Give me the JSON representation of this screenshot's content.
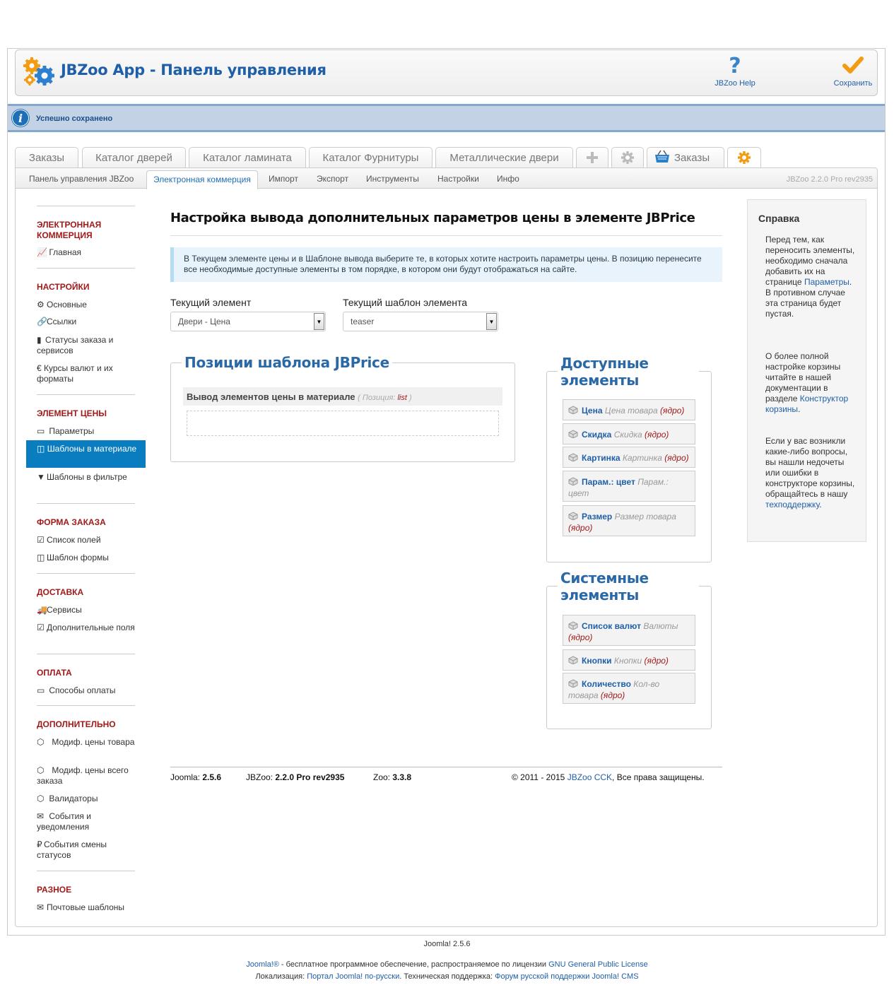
{
  "toolbar": {
    "title": "JBZoo App - Панель управления",
    "help_label": "JBZoo Help",
    "save_label": "Сохранить"
  },
  "message": "Успешно сохранено",
  "tabs": [
    {
      "label": "Заказы"
    },
    {
      "label": "Каталог дверей"
    },
    {
      "label": "Каталог ламината"
    },
    {
      "label": "Каталог Фурнитуры"
    },
    {
      "label": "Металлические двери"
    },
    {
      "label": ""
    },
    {
      "label": ""
    },
    {
      "label": "Заказы"
    },
    {
      "label": ""
    }
  ],
  "subnav": {
    "items": [
      {
        "label": "Панель управления JBZoo"
      },
      {
        "label": "Электронная коммерция"
      },
      {
        "label": "Импорт"
      },
      {
        "label": "Экспорт"
      },
      {
        "label": "Инструменты"
      },
      {
        "label": "Настройки"
      },
      {
        "label": "Инфо"
      }
    ],
    "version": "JBZoo 2.2.0 Pro rev2935"
  },
  "sidebar": {
    "sections": [
      {
        "title": "ЭЛЕКТРОННАЯ КОММЕРЦИЯ",
        "items": [
          "Главная"
        ]
      },
      {
        "title": "НАСТРОЙКИ",
        "items": [
          "Основные",
          "Ссылки",
          "Статусы заказа и сервисов",
          "Курсы валют и их форматы"
        ]
      },
      {
        "title": "ЭЛЕМЕНТ ЦЕНЫ",
        "items": [
          "Параметры",
          "Шаблоны в материале",
          "Шаблоны в фильтре"
        ]
      },
      {
        "title": "ФОРМА ЗАКАЗА",
        "items": [
          "Список полей",
          "Шаблон формы"
        ]
      },
      {
        "title": "ДОСТАВКА",
        "items": [
          "Сервисы",
          "Дополнительные поля"
        ]
      },
      {
        "title": "ОПЛАТА",
        "items": [
          "Способы оплаты"
        ]
      },
      {
        "title": "ДОПОЛНИТЕЛЬНО",
        "items": [
          "Модиф. цены товара",
          "Модиф. цены всего заказа",
          "Валидаторы",
          "События и уведомления",
          "События смены статусов"
        ]
      },
      {
        "title": "РАЗНОЕ",
        "items": [
          "Почтовые шаблоны"
        ]
      }
    ]
  },
  "main": {
    "title": "Настройка вывода дополнительных параметров цены в элементе JBPrice",
    "note": "В Текущем элементе цены и в Шаблоне вывода выберите те, в которых хотите настроить параметры цены. В позицию перенесите все необходимые доступные элементы в том порядке, в котором они будут отображаться на сайте.",
    "current_element_label": "Текущий элемент",
    "current_element_value": "Двери - Цена",
    "current_template_label": "Текущий шаблон элемента",
    "current_template_value": "teaser",
    "positions_title": "Позиции шаблона JBPrice",
    "position_name": "Вывод элементов цены в материале",
    "position_hint_prefix": "( Позиция:",
    "position_hint_key": "list",
    "position_hint_suffix": ")",
    "available_title": "Доступные элементы",
    "available": [
      {
        "name": "Цена",
        "desc": "Цена товара",
        "core": "(ядро)"
      },
      {
        "name": "Скидка",
        "desc": "Скидка",
        "core": "(ядро)"
      },
      {
        "name": "Картинка",
        "desc": "Картинка",
        "core": "(ядро)"
      },
      {
        "name": "Парам.: цвет",
        "desc": "Парам.: цвет",
        "core": ""
      },
      {
        "name": "Размер",
        "desc": "Размер товара",
        "core": "(ядро)"
      }
    ],
    "system_title": "Системные элементы",
    "system": [
      {
        "name": "Список валют",
        "desc": "Валюты",
        "core": "(ядро)"
      },
      {
        "name": "Кнопки",
        "desc": "Кнопки",
        "core": "(ядро)"
      },
      {
        "name": "Количество",
        "desc": "Кол-во товара",
        "core": "(ядро)"
      }
    ]
  },
  "help": {
    "title": "Справка",
    "p1_text": "Перед тем, как переносить элементы, необходимо сначала добавить их на странице",
    "p1_link": "Параметры",
    "p1_tail": ". В противном случае эта страница будет пустая.",
    "p2_text": "О более полной настройке корзины читайте в нашей документации в разделе",
    "p2_link": "Конструктор корзины",
    "p2_tail": ".",
    "p3_text": "Если у вас возникли какие-либо вопросы, вы нашли недочеты или ошибки в конструкторе корзины, обращайтесь в нашу",
    "p3_link": "техподдержку",
    "p3_tail": "."
  },
  "footer": {
    "joomla_label": "Joomla:",
    "joomla_ver": "2.5.6",
    "jbzoo_label": "JBZoo:",
    "jbzoo_ver": "2.2.0 Pro rev2935",
    "zoo_label": "Zoo:",
    "zoo_ver": "3.3.8",
    "copy_prefix": "© 2011 - 2015",
    "copy_link": "JBZoo CCK",
    "copy_suffix": ", Все права защищены."
  },
  "page_footer": {
    "version": "Joomla! 2.5.6",
    "l1_link1": "Joomla!®",
    "l1_text": " - бесплатное программное обеспечение, распространяемое по лицензии ",
    "l1_link2": "GNU General Public License",
    "l2_text1": "Локализация: ",
    "l2_link1": "Портал Joomla! по-русски",
    "l2_text2": ". Техническая поддержка: ",
    "l2_link2": "Форум русской поддержки Joomla! CMS"
  },
  "colors": {
    "accent": "#1f5fa8",
    "section_head": "#a11a1a",
    "active_item": "#0a7cc0",
    "message_bg": "#c3d2e5"
  }
}
